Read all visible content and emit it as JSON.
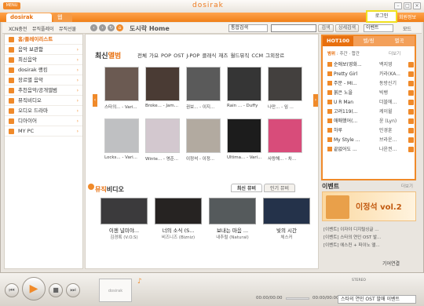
{
  "app": {
    "logo": "MENU",
    "title": "dosirak",
    "tab_active": "dosirak",
    "tab_other": "웹"
  },
  "account": {
    "login": "로그인",
    "info": "회원정보"
  },
  "nav": {
    "links": [
      "XCN충전",
      "뮤직플레이",
      "뮤직선물"
    ],
    "home_label": "도시락 Home",
    "search_select": "통합검색",
    "search_placeholder": "",
    "search_button": "검색",
    "detail_button": "상세검색",
    "site_select": "이벤트",
    "mode_label": "모드"
  },
  "sidebar": {
    "items": [
      {
        "label": "홈/플레이리스트",
        "active": true
      },
      {
        "label": "음악 보관함"
      },
      {
        "label": "최신음악"
      },
      {
        "label": "dosirak 랭킹"
      },
      {
        "label": "장르별 음악"
      },
      {
        "label": "추천음악/공개앨범"
      },
      {
        "label": "뮤직비디오"
      },
      {
        "label": "오디오 드라마"
      },
      {
        "label": "디아이어"
      },
      {
        "label": "MY PC"
      }
    ]
  },
  "albums": {
    "title_prefix": "최신",
    "title_highlight": "앨범",
    "genres": "전체  가요  POP  OST  J-POP  클래식  재즈  월드뮤직  CCM  그외장르",
    "items": [
      {
        "caption": "스타의... - Vari...",
        "color": "#6b5a52"
      },
      {
        "caption": "Broke... - Jam...",
        "color": "#4a3b34"
      },
      {
        "caption": "권보... - 이지...",
        "color": "#5a5a5a"
      },
      {
        "caption": "Rain ... - Duffy",
        "color": "#353535"
      },
      {
        "caption": "나만... - 임 ...",
        "color": "#43403e"
      },
      {
        "caption": "Locks... - Vari...",
        "color": "#bfc0c2"
      },
      {
        "caption": "Winte... - 영준...",
        "color": "#d3c8cf"
      },
      {
        "caption": "이정석 - 이정...",
        "color": "#b2aaa0"
      },
      {
        "caption": "Ultima... - Vari...",
        "color": "#1c1c1c"
      },
      {
        "caption": "사랑해... - 차...",
        "color": "#d84c7a"
      }
    ]
  },
  "chart": {
    "tabs": [
      "HOT100",
      "벨/링",
      "별곡"
    ],
    "period_label": "범위",
    "period_value": "주간 · 합간",
    "more": "더보기",
    "rows": [
      {
        "title": "순애보(영화...",
        "artist": "백지영"
      },
      {
        "title": "Pretty Girl",
        "artist": "카라(KA..."
      },
      {
        "title": "주문 - MI...",
        "artist": "동방신기"
      },
      {
        "title": "붉은 노을",
        "artist": "빅뱅"
      },
      {
        "title": "U R Man",
        "artist": "더블에..."
      },
      {
        "title": "고려119(...",
        "artist": "케이윌"
      },
      {
        "title": "애매했어(...",
        "artist": "윤 (Lyn)"
      },
      {
        "title": "하루",
        "artist": "민경훈"
      },
      {
        "title": "My Style ...",
        "artist": "브라운..."
      },
      {
        "title": "끝없어도 ...",
        "artist": "나윤권..."
      }
    ]
  },
  "videos": {
    "title_prefix": "뮤직",
    "title_highlight": "비디오",
    "tabs": [
      "최신 뮤비",
      "인기 뮤비"
    ],
    "items": [
      {
        "title": "이젠 널미야...",
        "artist": "김경록 (V.O.S)",
        "color": "#3b3a3c"
      },
      {
        "title": "너의 소식 (S...",
        "artist": "비즈니즈 (Bizniz)",
        "color": "#262322"
      },
      {
        "title": "보내는 마음 ...",
        "artist": "내추럴 (Natural)",
        "color": "#555a5c"
      },
      {
        "title": "빛의 시간",
        "artist": "체스커",
        "color": "#24324a"
      }
    ]
  },
  "event": {
    "title": "이벤트",
    "more": "더보기",
    "banner_text": "이정석 vol.2",
    "lines": [
      "[이벤트] 이자야 디지털싱글 ...",
      "[이벤트] 스타의 연인 OST 발...",
      "[이벤트] 에스컨 + 파이노 앨..."
    ],
    "fashion": "기어연결"
  },
  "player": {
    "lcd": "dosirak",
    "time_left": "00:00/00:00",
    "time_right": "00:00/00:00",
    "stereo": "STEREO",
    "playlist": "스타의 연인 OST 발매 이벤트"
  }
}
